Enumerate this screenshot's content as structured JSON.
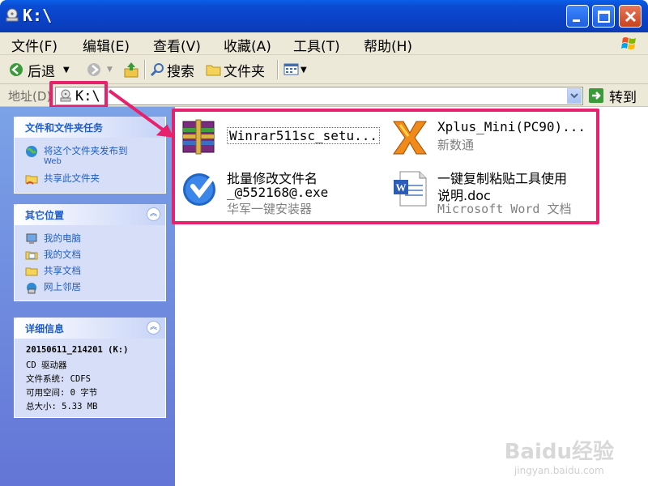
{
  "window": {
    "title": "K:\\"
  },
  "menu": [
    "文件(F)",
    "编辑(E)",
    "查看(V)",
    "收藏(A)",
    "工具(T)",
    "帮助(H)"
  ],
  "toolbar": {
    "back": "后退",
    "search": "搜索",
    "folders": "文件夹"
  },
  "address": {
    "label": "地址(D)",
    "value": "K:\\",
    "go": "转到"
  },
  "tasks_panel": {
    "title": "文件和文件夹任务",
    "items": [
      {
        "label": "将这个文件夹发布到",
        "sub": "Web",
        "icon": "globe-icon"
      },
      {
        "label": "共享此文件夹",
        "icon": "share-folder-icon"
      }
    ]
  },
  "places_panel": {
    "title": "其它位置",
    "items": [
      {
        "label": "我的电脑",
        "icon": "computer-icon"
      },
      {
        "label": "我的文档",
        "icon": "documents-icon"
      },
      {
        "label": "共享文档",
        "icon": "shared-folder-icon"
      },
      {
        "label": "网上邻居",
        "icon": "network-icon"
      }
    ]
  },
  "details_panel": {
    "title": "详细信息",
    "name": "20150611_214201 (K:)",
    "type": "CD 驱动器",
    "fs": "文件系统: CDFS",
    "free": "可用空间: 0 字节",
    "total": "总大小: 5.33 MB"
  },
  "files": [
    {
      "name": "Winrar511sc_setu...",
      "desc": "",
      "icon": "winrar-icon"
    },
    {
      "name": "Xplus_Mini(PC90)...",
      "desc": "新数通",
      "icon": "xplus-icon"
    },
    {
      "name": "批量修改文件名",
      "name2": "_@552168@.exe",
      "desc": "华军一键安装器",
      "icon": "installer-icon"
    },
    {
      "name": "一键复制粘贴工具使用",
      "name2": "说明.doc",
      "desc": "Microsoft Word 文档",
      "icon": "word-doc-icon"
    }
  ],
  "watermark": {
    "text": "Baidu经验",
    "sub": "jingyan.baidu.com"
  },
  "colors": {
    "highlight": "#e8216c",
    "titlebar": "#0a42c8",
    "link": "#215dc6"
  }
}
